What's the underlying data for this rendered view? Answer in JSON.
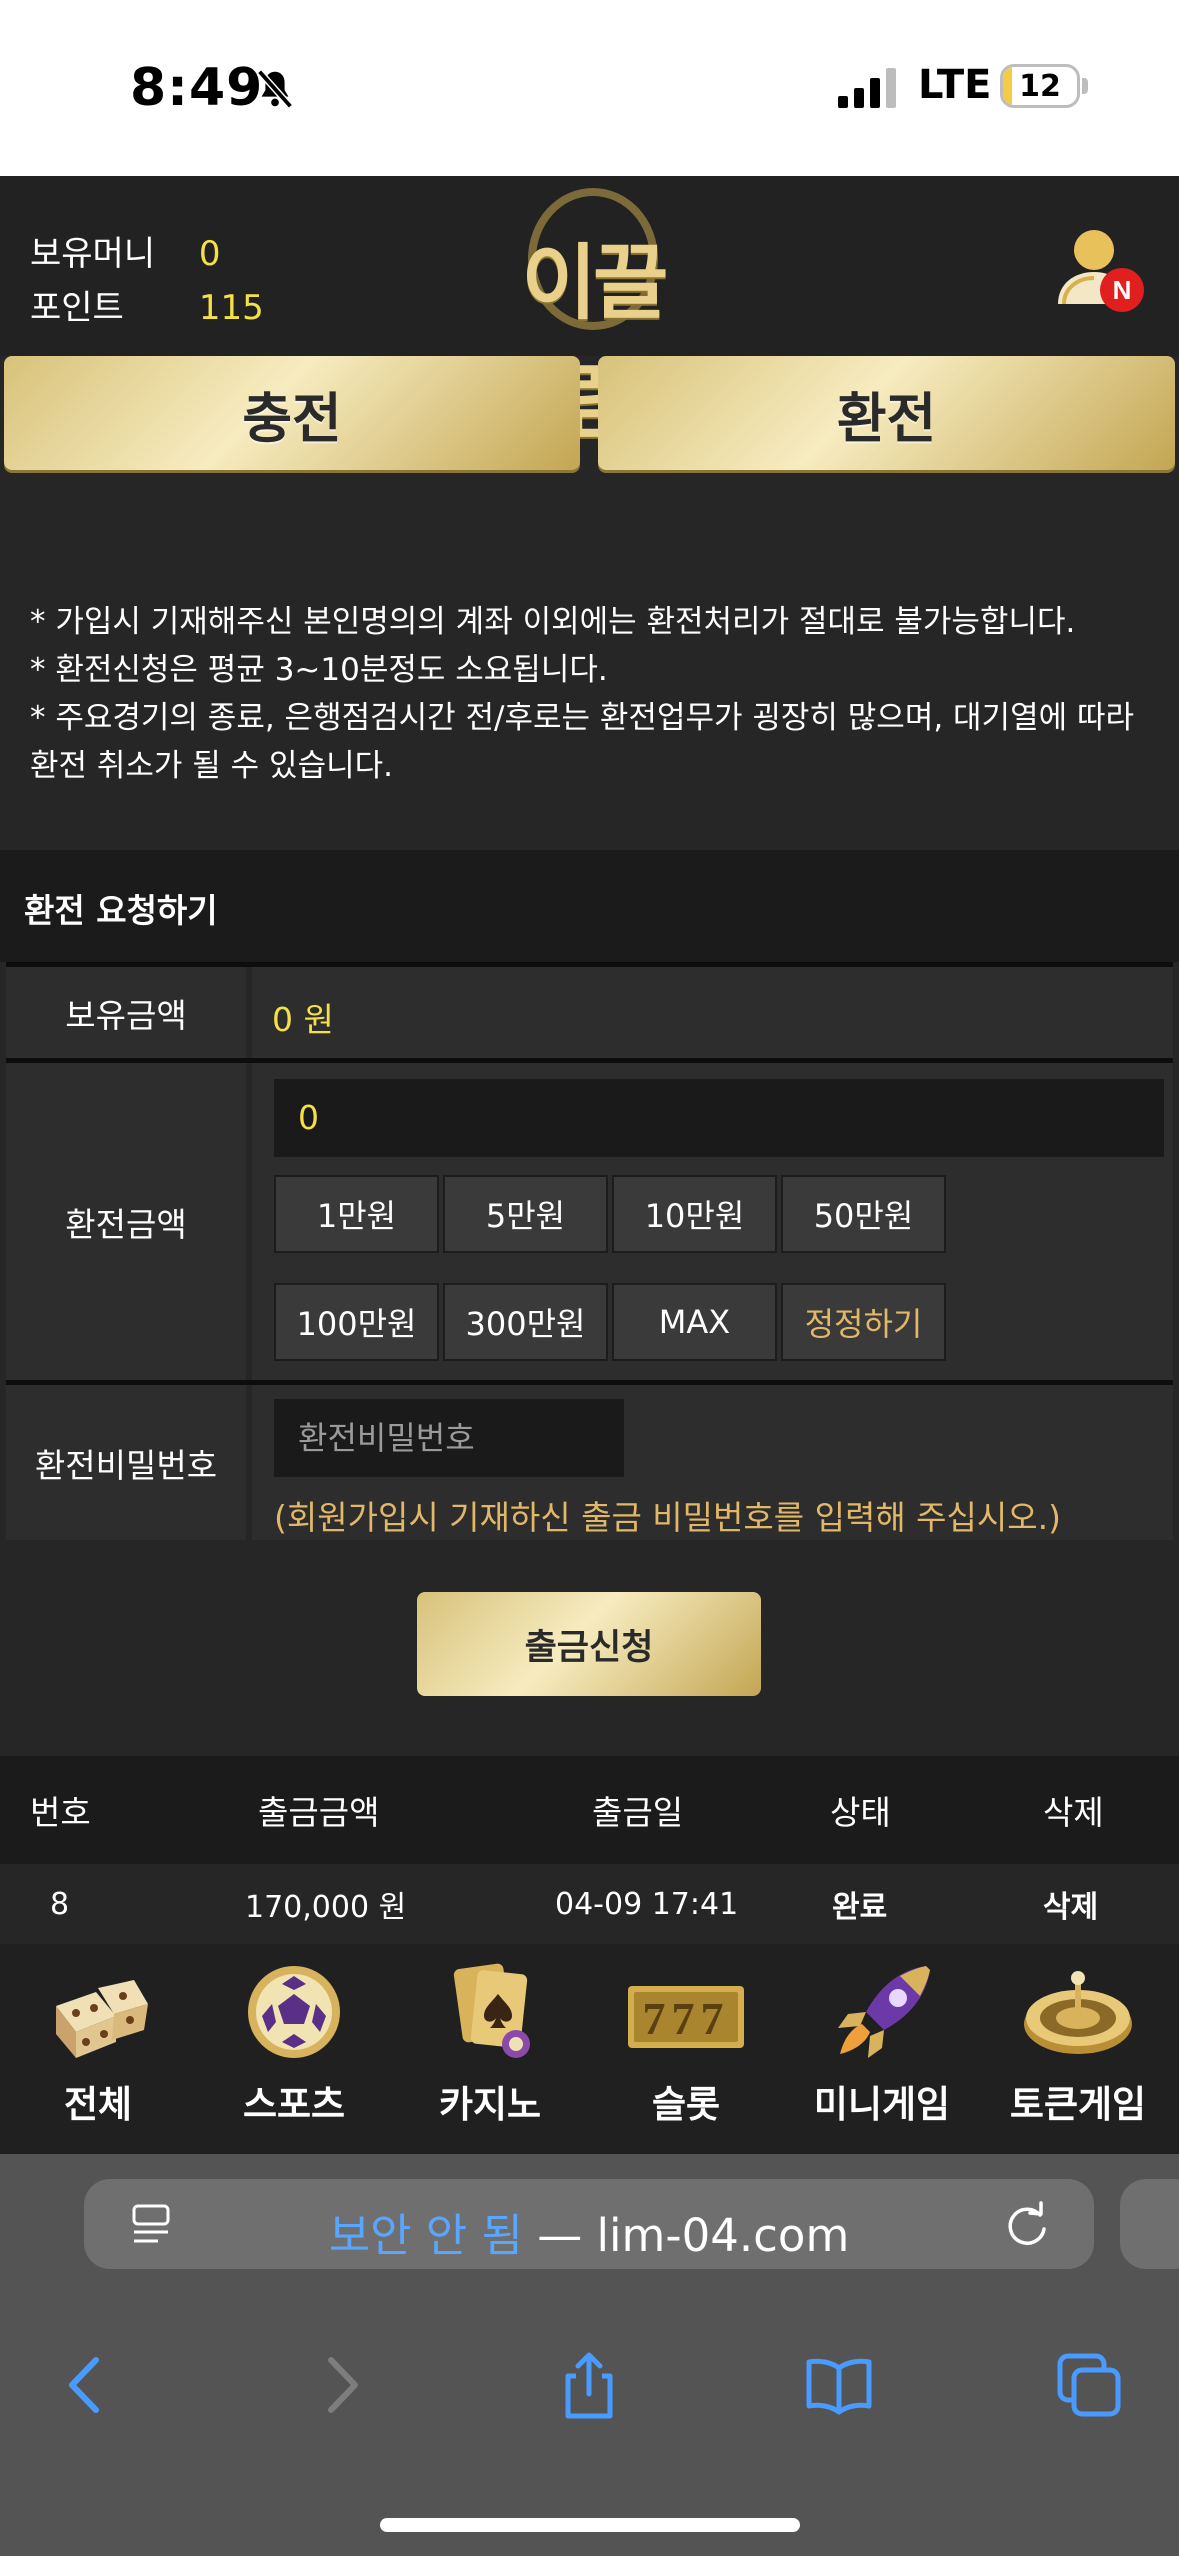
{
  "status_bar": {
    "time": "8:49",
    "network": "LTE",
    "battery": "12"
  },
  "header": {
    "balance_label": "보유머니",
    "balance_value": "0",
    "points_label": "포인트",
    "points_value": "115",
    "logo_text": "이끌림",
    "user_badge": "N"
  },
  "actions": {
    "deposit_label": "충전",
    "exchange_label": "환전"
  },
  "notices": [
    "* 가입시 기재해주신 본인명의의 계좌 이외에는 환전처리가 절대로 불가능합니다.",
    "* 환전신청은 평균 3~10분정도 소요됩니다.",
    "* 주요경기의 종료, 은행점검시간 전/후로는 환전업무가 굉장히 많으며, 대기열에 따라 환전 취소가 될 수 있습니다."
  ],
  "form": {
    "title": "환전 요청하기",
    "held_amount_label": "보유금액",
    "held_amount_value": "0 원",
    "exchange_amount_label": "환전금액",
    "exchange_amount_value": "0",
    "amount_buttons": [
      "1만원",
      "5만원",
      "10만원",
      "50만원",
      "100만원",
      "300만원",
      "MAX",
      "정정하기"
    ],
    "password_label": "환전비밀번호",
    "password_placeholder": "환전비밀번호",
    "password_hint": "(회원가입시 기재하신 출금 비밀번호를 입력해 주십시오.)",
    "submit_label": "출금신청"
  },
  "history": {
    "columns": [
      "번호",
      "출금금액",
      "출금일",
      "상태",
      "삭제"
    ],
    "rows": [
      {
        "no": "8",
        "amount": "170,000 원",
        "date": "04-09 17:41",
        "status": "완료",
        "delete": "삭제"
      }
    ]
  },
  "game_nav": [
    {
      "label": "전체",
      "icon": "dice-icon"
    },
    {
      "label": "스포츠",
      "icon": "soccer-ball-icon"
    },
    {
      "label": "카지노",
      "icon": "playing-cards-icon"
    },
    {
      "label": "슬롯",
      "icon": "slot-777-icon"
    },
    {
      "label": "미니게임",
      "icon": "rocket-icon"
    },
    {
      "label": "토큰게임",
      "icon": "roulette-icon"
    }
  ],
  "browser": {
    "security_label": "보안 안 됨",
    "separator": " — ",
    "domain": "lim-04.com"
  },
  "colors": {
    "accent_yellow": "#f5e146",
    "gold": "#d8c27a",
    "hint_orange": "#e2b868",
    "background": "#262626"
  }
}
